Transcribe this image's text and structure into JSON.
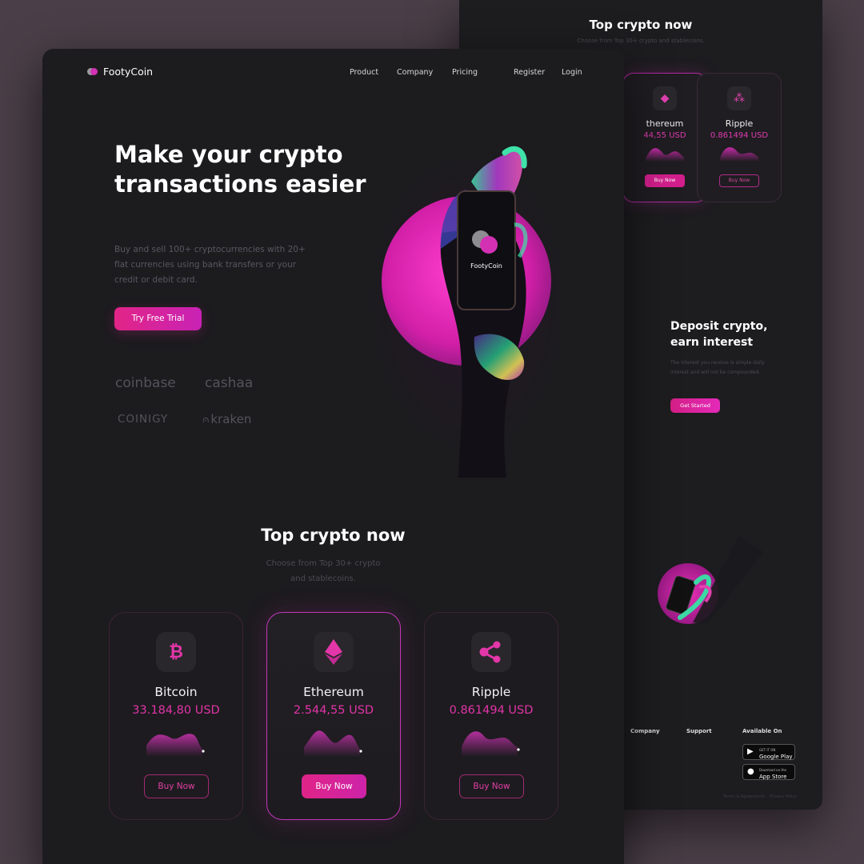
{
  "brand": {
    "name": "FootyCoin",
    "accent": "#d331b4"
  },
  "nav": {
    "items": [
      "Product",
      "Company",
      "Pricing"
    ],
    "register": "Register",
    "login": "Login"
  },
  "hero": {
    "title": "Make your crypto transactions easier",
    "subtitle": "Buy and sell 100+ cryptocurrencies with 20+ flat currencies using bank transfers or your credit or debit card.",
    "cta": "Try Free Trial",
    "phone_label": "FootyCoin"
  },
  "partners": [
    "coinbase",
    "cashaa",
    "COINIGY",
    "kraken"
  ],
  "top_crypto": {
    "title": "Top crypto now",
    "subtitle": "Choose from Top 30+ crypto and stablecoins.",
    "cards": [
      {
        "name": "Bitcoin",
        "price": "33.184,80 USD",
        "button": "Buy Now",
        "icon": "bitcoin-icon",
        "symbol": "₿"
      },
      {
        "name": "Ethereum",
        "price": "2.544,55 USD",
        "button": "Buy Now",
        "icon": "ethereum-icon",
        "symbol": "◆"
      },
      {
        "name": "Ripple",
        "price": "0.861494 USD",
        "button": "Buy Now",
        "icon": "ripple-icon",
        "symbol": "⁂"
      }
    ]
  },
  "back": {
    "title": "Top crypto now",
    "subtitle": "Choose from Top 30+ crypto and stablecoins.",
    "cards": [
      {
        "name": "thereum",
        "price": "44,55 USD",
        "button": "Buy Now"
      },
      {
        "name": "Ripple",
        "price": "0.861494 USD",
        "button": "Buy Now"
      }
    ],
    "deposit": {
      "title": "Deposit crypto, earn interest",
      "subtitle": "The interest you receive is simple daily interest and will not be compounded.",
      "button": "Get Started"
    },
    "footer": {
      "company": "Company",
      "support": "Support",
      "available": "Available On",
      "google": {
        "small": "GET IT ON",
        "big": "Google Play"
      },
      "apple": {
        "small": "Download on the",
        "big": "App Store"
      },
      "legal": [
        "Terms & Agreements",
        "Privacy Policy"
      ]
    }
  }
}
